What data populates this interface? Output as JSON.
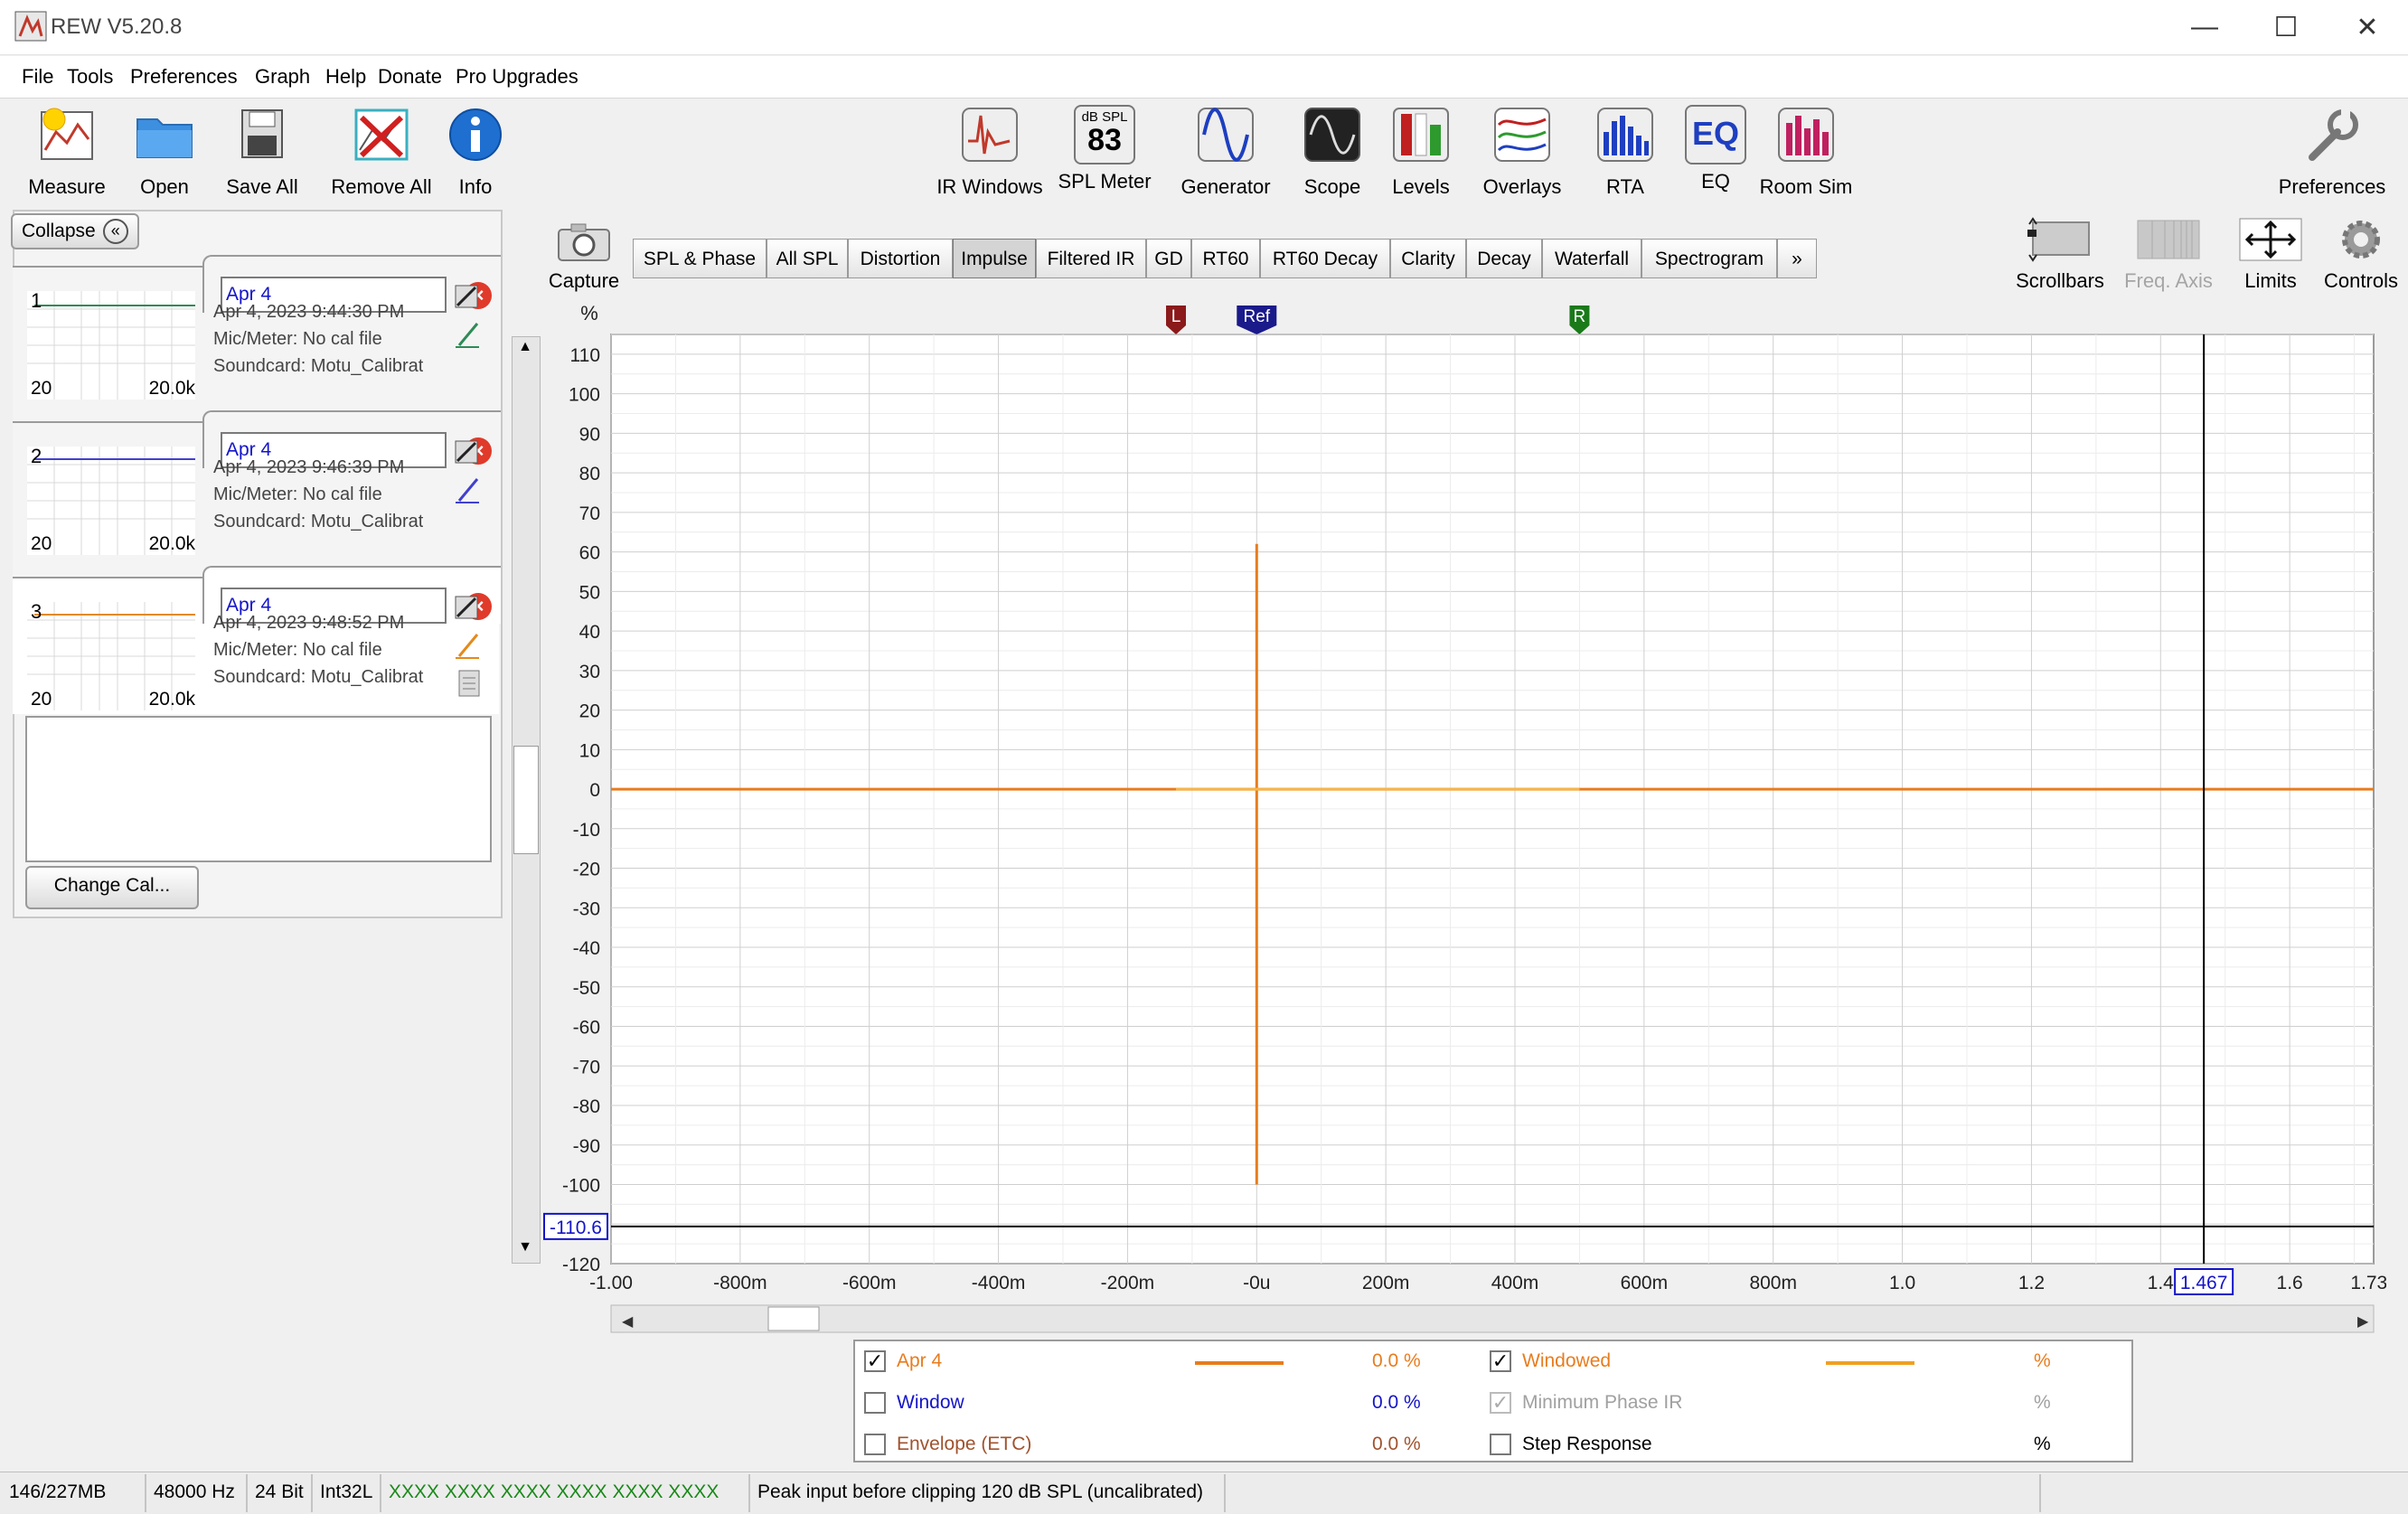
{
  "window": {
    "title": "REW V5.20.8",
    "minimize": "—",
    "maximize": "☐",
    "close": "✕"
  },
  "menu": [
    "File",
    "Tools",
    "Preferences",
    "Graph",
    "Help",
    "Donate",
    "Pro Upgrades"
  ],
  "toolbar_left": [
    {
      "label": "Measure",
      "icon": "measure-icon"
    },
    {
      "label": "Open",
      "icon": "folder-icon"
    },
    {
      "label": "Save All",
      "icon": "save-all-icon"
    },
    {
      "label": "Remove All",
      "icon": "remove-all-icon"
    },
    {
      "label": "Info",
      "icon": "info-icon"
    }
  ],
  "toolbar_center": [
    {
      "label": "IR Windows",
      "icon": "ir-windows-icon"
    },
    {
      "label": "SPL Meter",
      "icon": "spl-meter-icon",
      "top_text": "dB SPL",
      "value": "83"
    },
    {
      "label": "Generator",
      "icon": "generator-icon"
    },
    {
      "label": "Scope",
      "icon": "scope-icon"
    },
    {
      "label": "Levels",
      "icon": "levels-icon"
    },
    {
      "label": "Overlays",
      "icon": "overlays-icon"
    },
    {
      "label": "RTA",
      "icon": "rta-icon"
    },
    {
      "label": "EQ",
      "icon": "eq-icon"
    },
    {
      "label": "Room Sim",
      "icon": "room-sim-icon"
    }
  ],
  "toolbar_right": {
    "label": "Preferences",
    "icon": "wrench-icon"
  },
  "capture": {
    "label": "Capture",
    "icon": "camera-icon"
  },
  "graph_tabs": [
    "SPL & Phase",
    "All SPL",
    "Distortion",
    "Impulse",
    "Filtered IR",
    "GD",
    "RT60",
    "RT60 Decay",
    "Clarity",
    "Decay",
    "Waterfall",
    "Spectrogram",
    "»"
  ],
  "active_tab": "Impulse",
  "graph_controls": [
    {
      "label": "Scrollbars",
      "icon": "scrollbars-icon",
      "disabled": false
    },
    {
      "label": "Freq. Axis",
      "icon": "freq-axis-icon",
      "disabled": true
    },
    {
      "label": "Limits",
      "icon": "limits-icon",
      "disabled": false
    },
    {
      "label": "Controls",
      "icon": "gear-icon",
      "disabled": false
    }
  ],
  "collapse": {
    "label": "Collapse",
    "icon": "double-chevron-left-icon"
  },
  "measurements": [
    {
      "number": "1",
      "name": "Apr 4",
      "date": "Apr 4, 2023 9:44:30 PM",
      "mic": "Mic/Meter: No cal file",
      "soundcard": "Soundcard: Motu_Calibrat",
      "thumb_low": "20",
      "thumb_high": "20.0k",
      "color": "#2e8b57"
    },
    {
      "number": "2",
      "name": "Apr 4",
      "date": "Apr 4, 2023 9:46:39 PM",
      "mic": "Mic/Meter: No cal file",
      "soundcard": "Soundcard: Motu_Calibrat",
      "thumb_low": "20",
      "thumb_high": "20.0k",
      "color": "#4040d0"
    },
    {
      "number": "3",
      "name": "Apr 4",
      "date": "Apr 4, 2023 9:48:52 PM",
      "mic": "Mic/Meter: No cal file",
      "soundcard": "Soundcard: Motu_Calibrat",
      "thumb_low": "20",
      "thumb_high": "20.0k",
      "color": "#e38a1c"
    }
  ],
  "change_cal": "Change Cal...",
  "chart_data": {
    "type": "line",
    "ylabel": "%",
    "xlim": [
      -1.0,
      1.73
    ],
    "ylim": [
      -120,
      115
    ],
    "yticks": [
      "110",
      "100",
      "90",
      "80",
      "70",
      "60",
      "50",
      "40",
      "30",
      "20",
      "10",
      "0",
      "-10",
      "-20",
      "-30",
      "-40",
      "-50",
      "-60",
      "-70",
      "-80",
      "-90",
      "-100",
      "-120"
    ],
    "xticks": [
      {
        "v": -1.0,
        "label": "-1.00"
      },
      {
        "v": -0.8,
        "label": "-800m"
      },
      {
        "v": -0.6,
        "label": "-600m"
      },
      {
        "v": -0.4,
        "label": "-400m"
      },
      {
        "v": -0.2,
        "label": "-200m"
      },
      {
        "v": 0.0,
        "label": "-0u"
      },
      {
        "v": 0.2,
        "label": "200m"
      },
      {
        "v": 0.4,
        "label": "400m"
      },
      {
        "v": 0.6,
        "label": "600m"
      },
      {
        "v": 0.8,
        "label": "800m"
      },
      {
        "v": 1.0,
        "label": "1.0"
      },
      {
        "v": 1.2,
        "label": "1.2"
      },
      {
        "v": 1.4,
        "label": "1.4"
      },
      {
        "v": 1.6,
        "label": "1.6"
      },
      {
        "v": 1.73,
        "label": "1.73s"
      }
    ],
    "grid": true,
    "series": [
      {
        "name": "Apr 4",
        "color": "#e87c1e",
        "x": [
          -1.0,
          0.0,
          0.0,
          0.0,
          0.0,
          1.73
        ],
        "y": [
          0,
          0,
          62,
          -100,
          0,
          0
        ]
      }
    ],
    "window_markers": [
      {
        "label": "L",
        "x": -0.125,
        "color": "#8b1a1a"
      },
      {
        "label": "Ref",
        "x": 0.0,
        "color": "#1a1a8b"
      },
      {
        "label": "R",
        "x": 0.5,
        "color": "#1a7a1a"
      }
    ],
    "cursor": {
      "x": 1.467,
      "y": -110.6,
      "x_label": "1.467",
      "y_label": "-110.6"
    }
  },
  "legend": [
    {
      "checked": true,
      "label": "Apr 4",
      "value": "0.0 %",
      "color": "#e87c1e",
      "line_color": "#e87c1e"
    },
    {
      "checked": false,
      "label": "Window",
      "value": "0.0 %",
      "color": "#1414c8",
      "line_color": ""
    },
    {
      "checked": false,
      "label": "Envelope (ETC)",
      "value": "0.0 %",
      "color": "#a0522d",
      "line_color": ""
    },
    {
      "checked": true,
      "label": "Windowed",
      "value": "%",
      "color": "#e87c1e",
      "line_color": "#f0a020"
    },
    {
      "checked": true,
      "label": "Minimum Phase IR",
      "value": "%",
      "color": "#a0a0a0",
      "line_color": "",
      "disabled": true
    },
    {
      "checked": false,
      "label": "Step Response",
      "value": "%",
      "color": "#000000",
      "line_color": ""
    }
  ],
  "status": [
    "146/227MB",
    "48000 Hz",
    "24 Bit",
    "Int32L",
    "XXXX XXXX  XXXX XXXX  XXXX XXXX",
    "Peak input before clipping 120 dB SPL (uncalibrated)"
  ]
}
